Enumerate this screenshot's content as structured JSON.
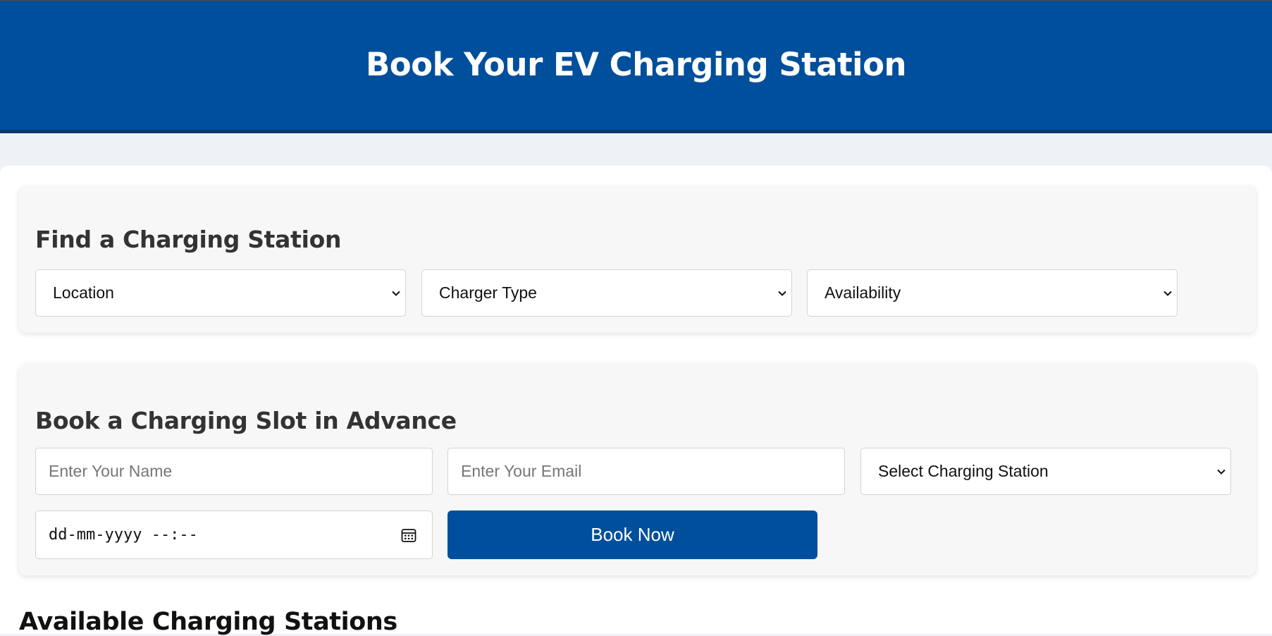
{
  "header": {
    "title": "Book Your EV Charging Station"
  },
  "find": {
    "title": "Find a Charging Station",
    "location": "Location",
    "charger_type": "Charger Type",
    "availability": "Availability"
  },
  "book": {
    "title": "Book a Charging Slot in Advance",
    "name_placeholder": "Enter Your Name",
    "email_placeholder": "Enter Your Email",
    "station_select": "Select Charging Station",
    "datetime_placeholder": "dd-mm-yyyy --:--",
    "submit_label": "Book Now"
  },
  "stations": {
    "title": "Available Charging Stations"
  },
  "icons": {
    "dropdown": "chevron-down-icon",
    "calendar": "calendar-icon"
  },
  "colors": {
    "brand": "#004f9c",
    "page_bg": "#eef2f7",
    "card_bg": "#f7f7f7"
  }
}
